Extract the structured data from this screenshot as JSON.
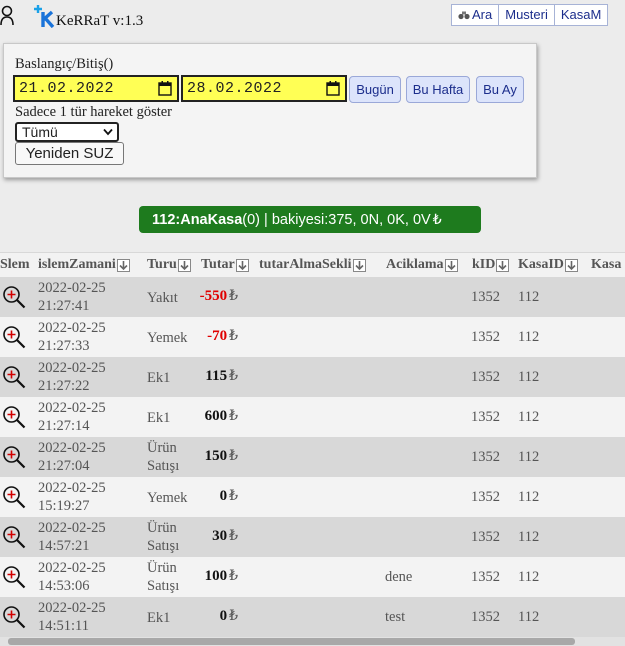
{
  "app": {
    "title": "KeRRaT v:1.3"
  },
  "nav": [
    {
      "label": "Ara",
      "icon": "binoculars-icon"
    },
    {
      "label": "Musteri"
    },
    {
      "label": "KasaM"
    }
  ],
  "filter": {
    "date_label": "Baslangıç/Bitiş()",
    "start_date": "21.02.2022",
    "end_date": "28.02.2022",
    "today_label": "Bugün",
    "week_label": "Bu Hafta",
    "month_label": "Bu Ay",
    "type_label": "Sadece 1 tür hareket göster",
    "type_selected": "Tümü",
    "refilter_label": "Yeniden SUZ"
  },
  "kasa": {
    "name": "112:AnaKasa",
    "count": "(0)",
    "balance_text": " | bakiyesi:375, ",
    "n": "0N",
    "k": "0K",
    "v": "0V",
    "currency": "₺"
  },
  "table": {
    "columns": [
      "Slem",
      "islemZamani",
      "Turu",
      "Tutar",
      "tutarAlmaSekli",
      "Aciklama",
      "kID",
      "KasaID",
      "Kasa"
    ],
    "rows": [
      {
        "date": "2022-02-25",
        "time": "21:27:41",
        "type1": "Yakıt",
        "type2": "",
        "amount": "-550",
        "neg": true,
        "desc": "",
        "kid": "1352",
        "kasa": "112"
      },
      {
        "date": "2022-02-25",
        "time": "21:27:33",
        "type1": "Yemek",
        "type2": "",
        "amount": "-70",
        "neg": true,
        "desc": "",
        "kid": "1352",
        "kasa": "112"
      },
      {
        "date": "2022-02-25",
        "time": "21:27:22",
        "type1": "Ek1",
        "type2": "",
        "amount": "115",
        "neg": false,
        "desc": "",
        "kid": "1352",
        "kasa": "112"
      },
      {
        "date": "2022-02-25",
        "time": "21:27:14",
        "type1": "Ek1",
        "type2": "",
        "amount": "600",
        "neg": false,
        "desc": "",
        "kid": "1352",
        "kasa": "112"
      },
      {
        "date": "2022-02-25",
        "time": "21:27:04",
        "type1": "Ürün",
        "type2": "Satışı",
        "amount": "150",
        "neg": false,
        "desc": "",
        "kid": "1352",
        "kasa": "112"
      },
      {
        "date": "2022-02-25",
        "time": "15:19:27",
        "type1": "Yemek",
        "type2": "",
        "amount": "0",
        "neg": false,
        "desc": "",
        "kid": "1352",
        "kasa": "112"
      },
      {
        "date": "2022-02-25",
        "time": "14:57:21",
        "type1": "Ürün",
        "type2": "Satışı",
        "amount": "30",
        "neg": false,
        "desc": "",
        "kid": "1352",
        "kasa": "112"
      },
      {
        "date": "2022-02-25",
        "time": "14:53:06",
        "type1": "Ürün",
        "type2": "Satışı",
        "amount": "100",
        "neg": false,
        "desc": "dene",
        "kid": "1352",
        "kasa": "112"
      },
      {
        "date": "2022-02-25",
        "time": "14:51:11",
        "type1": "Ek1",
        "type2": "",
        "amount": "0",
        "neg": false,
        "desc": "test",
        "kid": "1352",
        "kasa": "112"
      }
    ]
  }
}
